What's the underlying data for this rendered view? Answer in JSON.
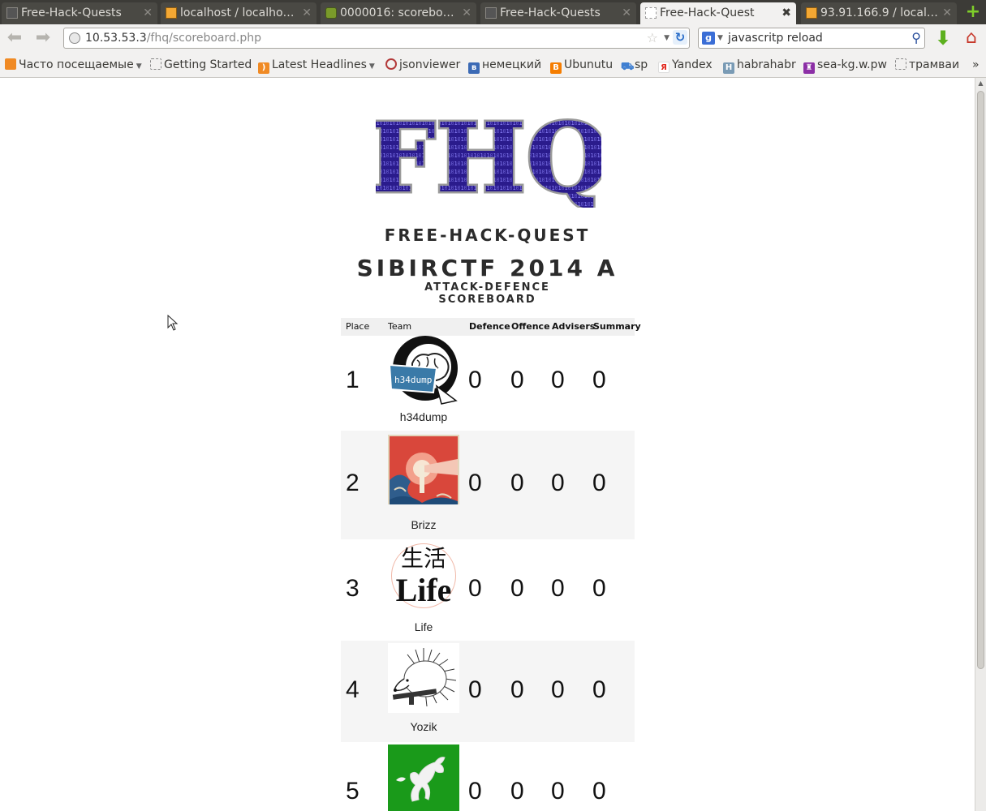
{
  "browser": {
    "tabs": [
      {
        "title": "Free-Hack-Quests",
        "active": false,
        "icon": "blank-page-icon"
      },
      {
        "title": "localhost / localhos…",
        "active": false,
        "icon": "phpmyadmin-icon"
      },
      {
        "title": "0000016: scoreboar…",
        "active": false,
        "icon": "bugtracker-icon"
      },
      {
        "title": "Free-Hack-Quests",
        "active": false,
        "icon": "blank-page-icon"
      },
      {
        "title": "Free-Hack-Quest",
        "active": true,
        "icon": "blank-page-icon"
      },
      {
        "title": "93.91.166.9 / localh…",
        "active": false,
        "icon": "phpmyadmin-icon"
      }
    ],
    "new_tab_label": "+",
    "url_host": "10.53.53.3",
    "url_path": "/fhq/scoreboard.php",
    "search_engine": "g",
    "search_text": "javascritp reload",
    "bookmarks": [
      {
        "label": "Часто посещаемые",
        "icon": "rss-folder-icon",
        "color": "#f08a24",
        "dropdown": true
      },
      {
        "label": "Getting Started",
        "icon": "blank-page-icon",
        "color": "#ffffff",
        "dropdown": false
      },
      {
        "label": "Latest Headlines",
        "icon": "rss-icon",
        "color": "#f08a24",
        "dropdown": true
      },
      {
        "label": "jsonviewer",
        "icon": "jsonviewer-icon",
        "color": "#b33a3a",
        "dropdown": false
      },
      {
        "label": "немецкий",
        "icon": "vk-icon",
        "color": "#3c6ab5",
        "dropdown": false
      },
      {
        "label": "Ubunutu",
        "icon": "blogger-icon",
        "color": "#f57d00",
        "dropdown": false
      },
      {
        "label": "sp",
        "icon": "cart-icon",
        "color": "#3f7fd1",
        "dropdown": false
      },
      {
        "label": "Yandex",
        "icon": "yandex-icon",
        "color": "#e1261c",
        "dropdown": false
      },
      {
        "label": "habrahabr",
        "icon": "habr-icon",
        "color": "#7a9bb5",
        "dropdown": false
      },
      {
        "label": "sea-kg.w.pw",
        "icon": "castle-icon",
        "color": "#8c2fa6",
        "dropdown": false
      },
      {
        "label": "трамваи",
        "icon": "blank-page-icon",
        "color": "#ffffff",
        "dropdown": false
      }
    ],
    "bookmarks_more": "»"
  },
  "page": {
    "logo_text": "FHQ",
    "site_name": "Free-Hack-Quest",
    "event_title": "SibirCTF 2014 A",
    "event_subtitle_1": "Attack-Defence",
    "event_subtitle_2": "Scoreboard",
    "table": {
      "headers": {
        "place": "Place",
        "team": "Team",
        "defence": "Defence",
        "offence": "Offence",
        "advisers": "Advisers",
        "summary": "Summary"
      },
      "rows": [
        {
          "place": "1",
          "team": "h34dump",
          "defence": "0",
          "offence": "0",
          "advisers": "0",
          "summary": "0",
          "avatar": "brain-logo",
          "avatar_bg": "#ffffff"
        },
        {
          "place": "2",
          "team": "Brizz",
          "defence": "0",
          "offence": "0",
          "advisers": "0",
          "summary": "0",
          "avatar": "lighthouse-logo",
          "avatar_bg": "#d9473b"
        },
        {
          "place": "3",
          "team": "Life",
          "defence": "0",
          "offence": "0",
          "advisers": "0",
          "summary": "0",
          "avatar": "life-kanji-logo",
          "avatar_bg": "#ffffff",
          "avatar_text": "生活",
          "avatar_word": "Life"
        },
        {
          "place": "4",
          "team": "Yozik",
          "defence": "0",
          "offence": "0",
          "advisers": "0",
          "summary": "0",
          "avatar": "hedgehog-logo",
          "avatar_bg": "#ffffff"
        },
        {
          "place": "5",
          "team": "",
          "defence": "0",
          "offence": "0",
          "advisers": "0",
          "summary": "0",
          "avatar": "horse-logo",
          "avatar_bg": "#1a9a1a"
        }
      ]
    }
  }
}
